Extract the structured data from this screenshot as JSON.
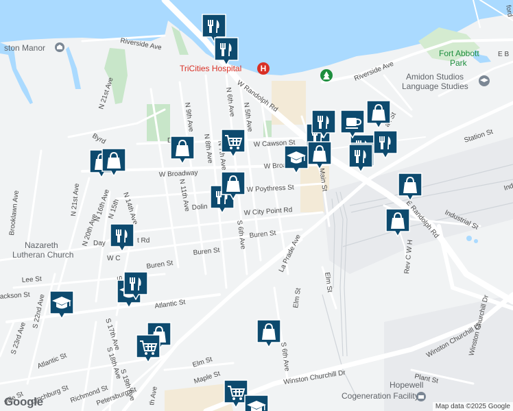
{
  "attribution": "Map data ©2025 Google",
  "logo_text": "Google",
  "colors": {
    "water": "#aadaff",
    "land": "#f1f3f4",
    "road": "#ffffff",
    "park": "#c8e6c9",
    "marker": "#0d4a6e",
    "hospital": "#d93025"
  },
  "pois": {
    "manor": "ston Manor",
    "hospital": "TriCities Hospital",
    "fort_abbott": "Fort Abbott",
    "park": "Park",
    "amidon1": "Amidon Studios",
    "amidon2": "Language Studies",
    "nazareth1": "Nazareth",
    "nazareth2": "Lutheran Church",
    "hopewell": "Hopewell",
    "cogeneration": "Cogeneration Facility"
  },
  "streets": {
    "riverside_w": "Riverside Ave",
    "riverside_e": "Riverside Ave",
    "n21st": "N 21st Ave",
    "n9th": "N 9th Ave",
    "n6th": "N 6th Ave",
    "n5th": "N 5th Ave",
    "n8th": "N 8th Ave",
    "n7th": "N 7th Ave",
    "n11th": "N 11th Ave",
    "w_randolph": "W Randolph Rd",
    "e_randolph": "E Randolph Rd",
    "w_cawson": "W Cawson St",
    "w_broadway_w": "W Broadway",
    "w_broadway_e": "W Broa",
    "w_poythress": "W Poythress St",
    "w_city_point": "W City Point Rd",
    "dolin": "Dolin",
    "buren_e": "Buren St",
    "buren_w": "Buren St",
    "buren_far": "Buren St",
    "s6th": "S 6th Ave",
    "la_prade": "La Prade Ave",
    "elm1": "Elm St",
    "elm2": "Elm St",
    "elm3": "Elm St",
    "main": "Main St",
    "station": "Station St",
    "industrial": "Industrial St",
    "ind": "Ind",
    "rev_cw": "Rev C W H",
    "winston_n": "Winston Churchill Dr",
    "winston_s": "Winston Churchill Dr",
    "winston_e": "Winston Churchill Dr",
    "plant": "Plant St",
    "s6th_b": "S 6th Ave",
    "maple": "Maple St",
    "elm_sw": "Elm St",
    "brooklawn": "Brooklawn Ave",
    "n21st_b": "N 21st Ave",
    "n20th": "N 20th Ave",
    "n16th": "N 16th Ave",
    "n15th": "N 15th",
    "n14th": "N 14th Ave",
    "byrd": "Byrd",
    "day": "Day",
    "rd": "t Rd",
    "w_c": "W C",
    "s1": "S 1",
    "lee": "Lee St",
    "jackson": "ackson St",
    "atlantic_e": "Atlantic St",
    "atlantic_w": "Atlantic St",
    "s22nd": "S 22nd Ave",
    "s23rd": "S 23rd Ave",
    "s17th": "S 17th Ave",
    "s18th": "S 18th Ave",
    "s19th": "S 19th Ave",
    "lynchburg": "Lynchburg St",
    "richmond": "Richmond St",
    "petersburg": "Petersburg St",
    "ville": "ville St",
    "th_ave": "th Ave",
    "d": "D",
    "ax": "ax St",
    "e_b": "E B",
    "ford": "ford"
  },
  "markers": [
    {
      "icon": "restaurant",
      "name": "restaurant-marker-1"
    },
    {
      "icon": "restaurant",
      "name": "restaurant-marker-2"
    },
    {
      "icon": "restaurant",
      "name": "restaurant-marker-3"
    },
    {
      "icon": "restaurant",
      "name": "restaurant-marker-4"
    },
    {
      "icon": "restaurant",
      "name": "restaurant-marker-5"
    },
    {
      "icon": "restaurant",
      "name": "restaurant-marker-6"
    },
    {
      "icon": "restaurant",
      "name": "restaurant-marker-7"
    },
    {
      "icon": "restaurant",
      "name": "restaurant-marker-8"
    },
    {
      "icon": "shopping-bag",
      "name": "shopping-marker-1"
    },
    {
      "icon": "shopping-bag",
      "name": "shopping-marker-2"
    },
    {
      "icon": "shopping-bag",
      "name": "shopping-marker-3"
    },
    {
      "icon": "shopping-bag",
      "name": "shopping-marker-4"
    },
    {
      "icon": "shopping-bag",
      "name": "shopping-marker-5"
    },
    {
      "icon": "shopping-bag",
      "name": "shopping-marker-6"
    },
    {
      "icon": "shopping-bag",
      "name": "shopping-marker-7"
    },
    {
      "icon": "shopping-bag",
      "name": "shopping-marker-8"
    },
    {
      "icon": "shopping-bag",
      "name": "shopping-marker-9"
    },
    {
      "icon": "shopping-bag",
      "name": "shopping-marker-10"
    },
    {
      "icon": "shopping-cart",
      "name": "grocery-marker-1"
    },
    {
      "icon": "shopping-cart",
      "name": "grocery-marker-2"
    },
    {
      "icon": "shopping-cart",
      "name": "grocery-marker-3"
    },
    {
      "icon": "school",
      "name": "school-marker-1"
    },
    {
      "icon": "school",
      "name": "school-marker-2"
    },
    {
      "icon": "school",
      "name": "school-marker-3"
    },
    {
      "icon": "school",
      "name": "school-marker-4"
    },
    {
      "icon": "cafe",
      "name": "cafe-marker-1"
    },
    {
      "icon": "restaurant",
      "name": "restaurant-marker-9"
    },
    {
      "icon": "restaurant",
      "name": "restaurant-marker-10"
    },
    {
      "icon": "restaurant",
      "name": "restaurant-marker-11"
    }
  ]
}
